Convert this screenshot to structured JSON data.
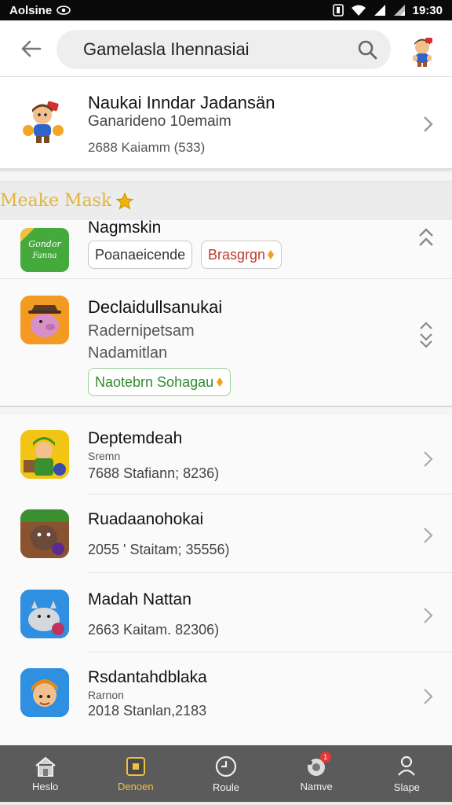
{
  "status_bar": {
    "carrier": "Aolsine",
    "time": "19:30"
  },
  "search": {
    "query": "Gamelasla Ihennasiai"
  },
  "featured": {
    "title": "Naukai Inndar Jadansän",
    "subtitle": "Ganarideno 10emaim",
    "meta": "2688 Kaiamm (533)"
  },
  "section": {
    "title": "Meake Mask"
  },
  "expand_items": [
    {
      "title": "Nagmskin",
      "icon_text": "Gondor Fanna",
      "chips": [
        "Poanaeicende",
        "Brasgrgn"
      ],
      "chip_colors": [
        "#333333",
        "#c0392b"
      ]
    },
    {
      "title": "Declaidullsanukai",
      "subtitle": "Radernipetsam",
      "subtitle2": "Nadamitlan",
      "chips": [
        "Naotebrn Sohagau"
      ],
      "chip_colors": [
        "#2e8b2e"
      ]
    }
  ],
  "list": [
    {
      "title": "Deptemdeah",
      "small": "Sremn",
      "meta": "7688  Stafiann; 8236)"
    },
    {
      "title": "Ruadaanohokai",
      "small": "",
      "meta": "2055 ' Staitam; 35556)"
    },
    {
      "title": "Madah Nattan",
      "small": "",
      "meta": "2663  Kaitam. 82306)"
    },
    {
      "title": "Rsdantahdblaka",
      "small": "Rarnon",
      "meta": "2018  Stanlan,2183"
    }
  ],
  "nav": [
    {
      "label": "Heslo",
      "icon": "home-icon"
    },
    {
      "label": "Denoen",
      "icon": "games-icon"
    },
    {
      "label": "Roule",
      "icon": "clock-icon"
    },
    {
      "label": "Namve",
      "icon": "camera-icon",
      "badge": "1"
    },
    {
      "label": "Slape",
      "icon": "profile-icon"
    }
  ],
  "colors": {
    "accent": "#f0c040",
    "section_title": "#e4b43a",
    "nav_bg": "#5b5b5b"
  }
}
